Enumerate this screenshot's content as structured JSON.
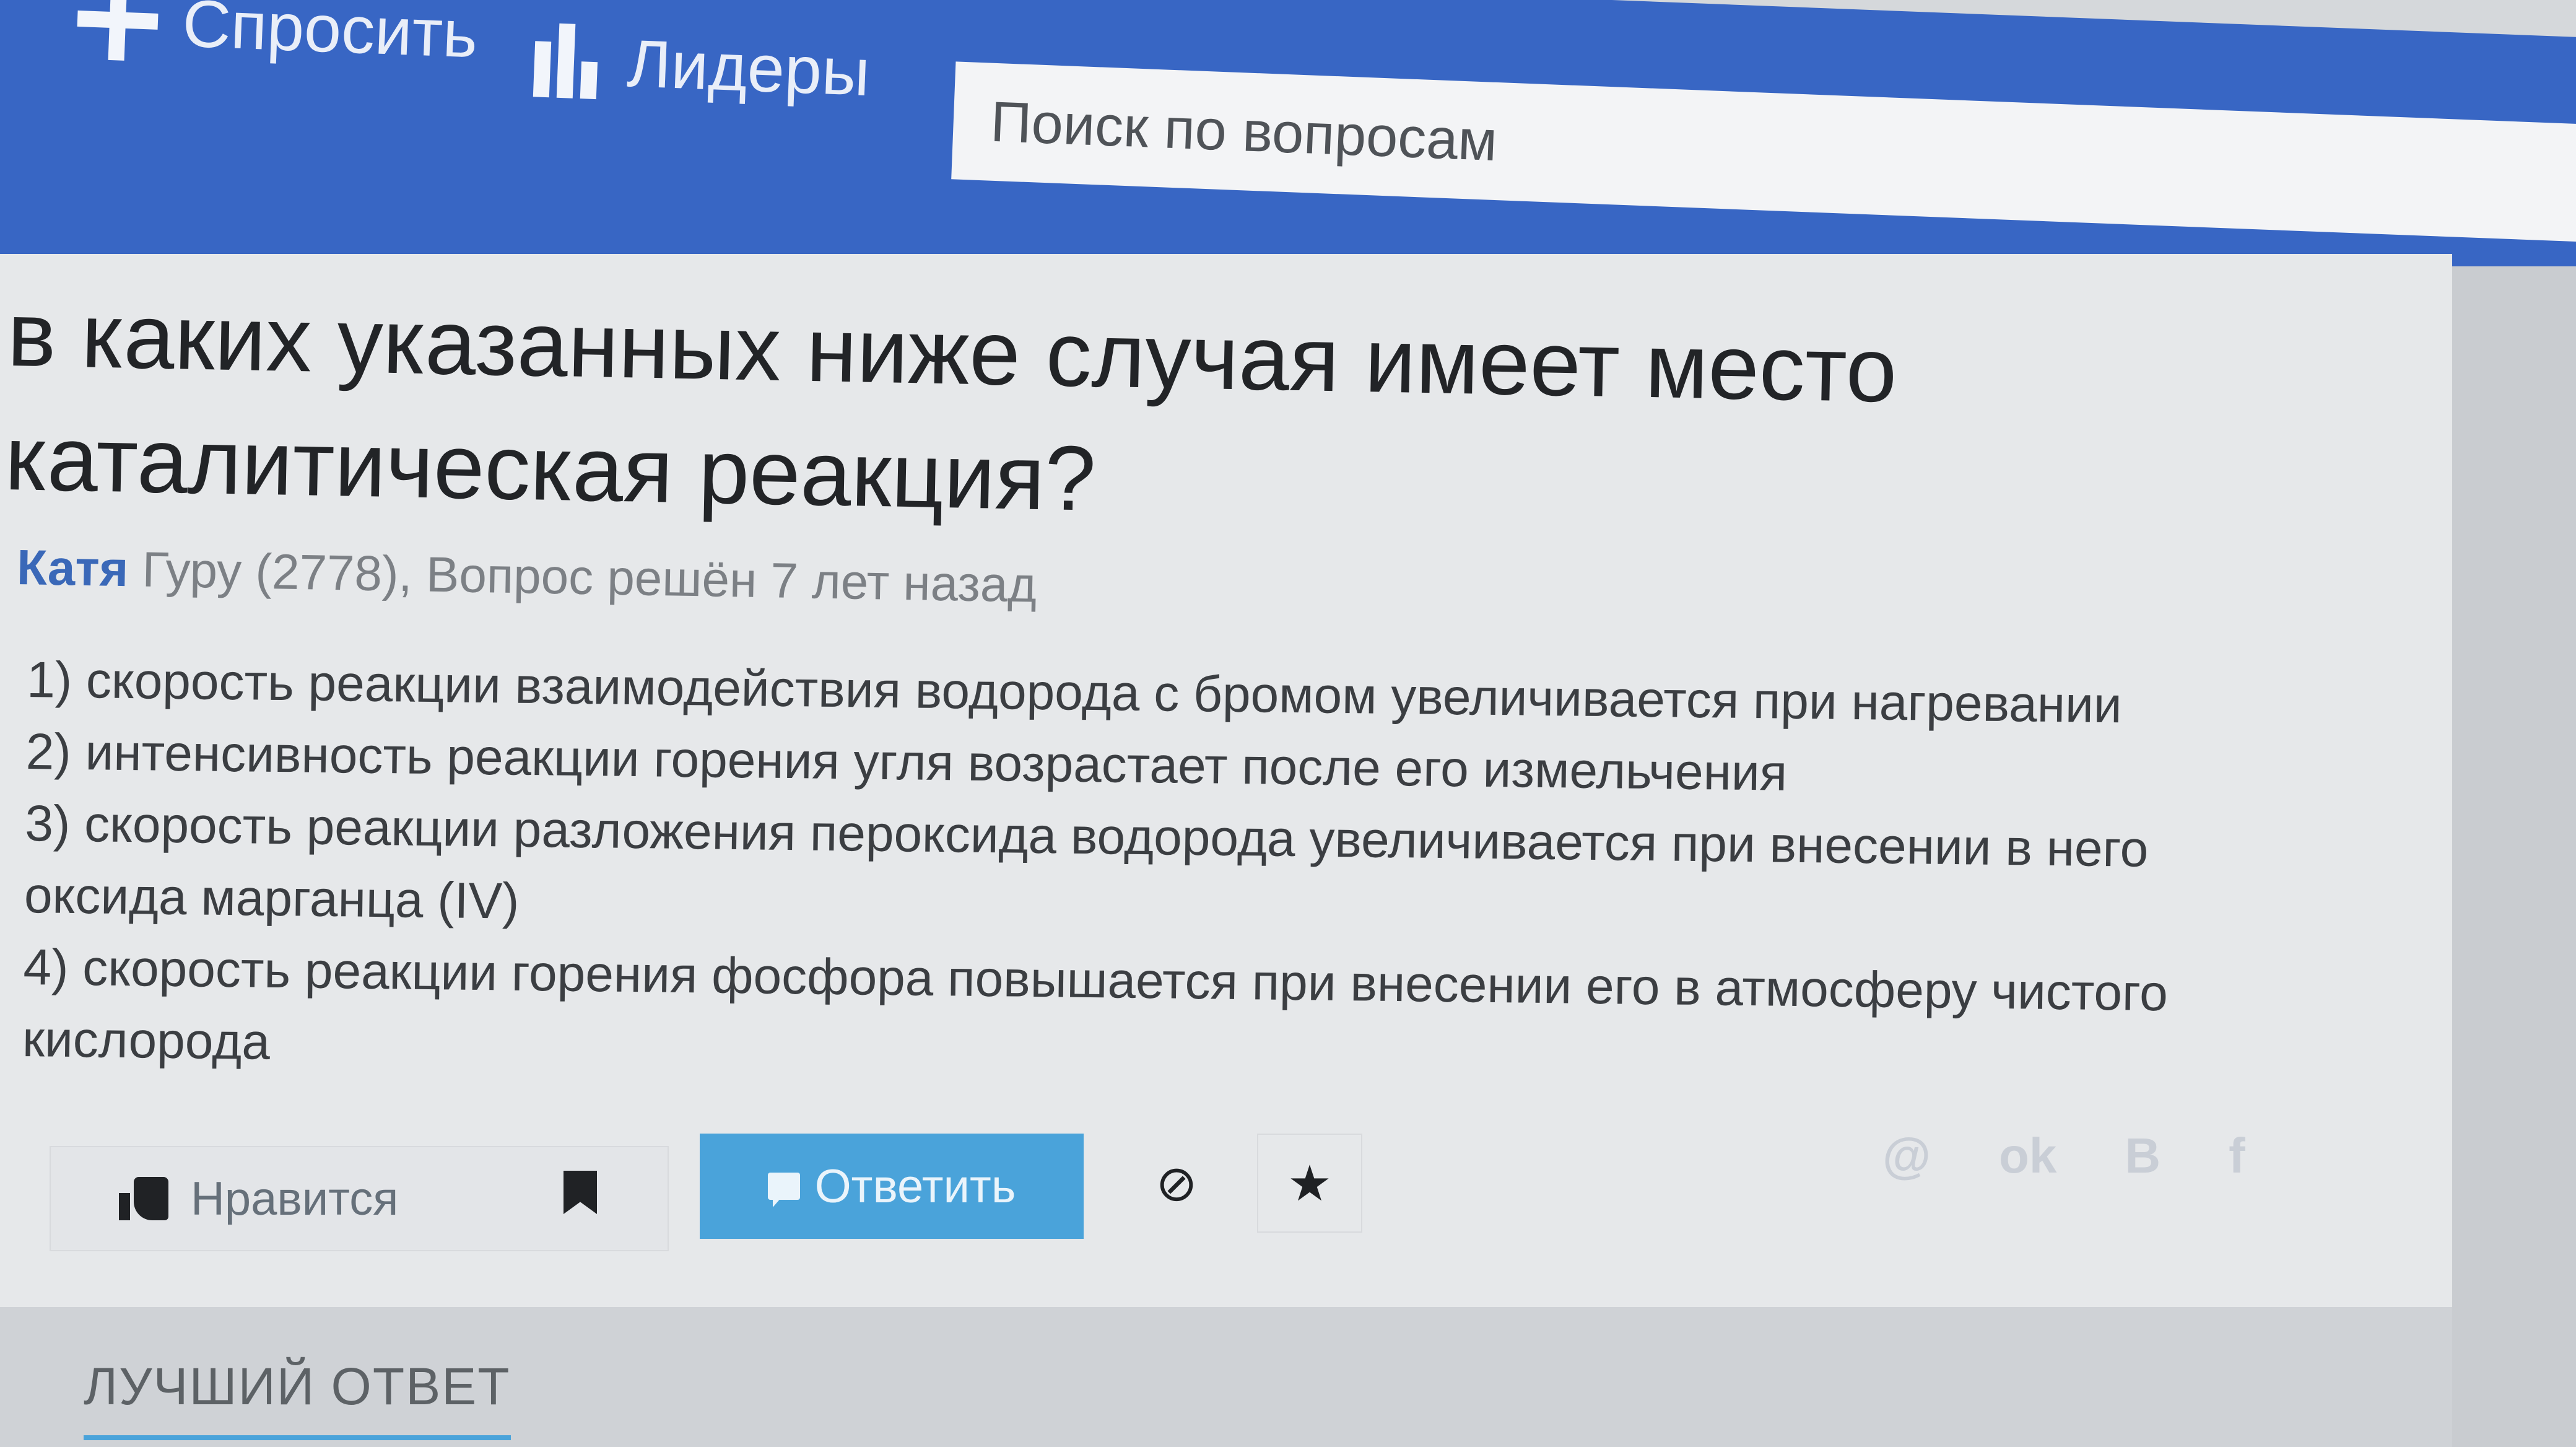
{
  "nav": {
    "ask_label": "Спросить",
    "leaders_label": "Лидеры",
    "search_placeholder": "Поиск по вопросам"
  },
  "question": {
    "title": "в каких указанных ниже случая имеет место каталитическая реакция?",
    "author": "Катя",
    "author_rank": "Гуру (2778), Вопрос решён 7 лет назад",
    "items": [
      "1) скорость реакции взаимодействия водорода с бромом увеличивается при нагревании",
      "2) интенсивность реакции горения угля возрастает после его измельчения",
      "3) скорость реакции разложения пероксида водорода увеличивается при внесении в него оксида марганца (IV)",
      "4) скорость реакции горения фосфора повышается при внесении его в атмосферу чистого кислорода"
    ]
  },
  "actions": {
    "like_label": "Нравится",
    "answer_label": "Ответить",
    "block_glyph": "⊘",
    "star_glyph": "★",
    "social": [
      "@",
      "ok",
      "B",
      "f"
    ]
  },
  "best_answer_label": "ЛУЧШИЙ ОТВЕТ",
  "colors": {
    "nav_bg": "#3866c4",
    "answer_btn": "#4aa3da",
    "author_link": "#3a68b8"
  }
}
